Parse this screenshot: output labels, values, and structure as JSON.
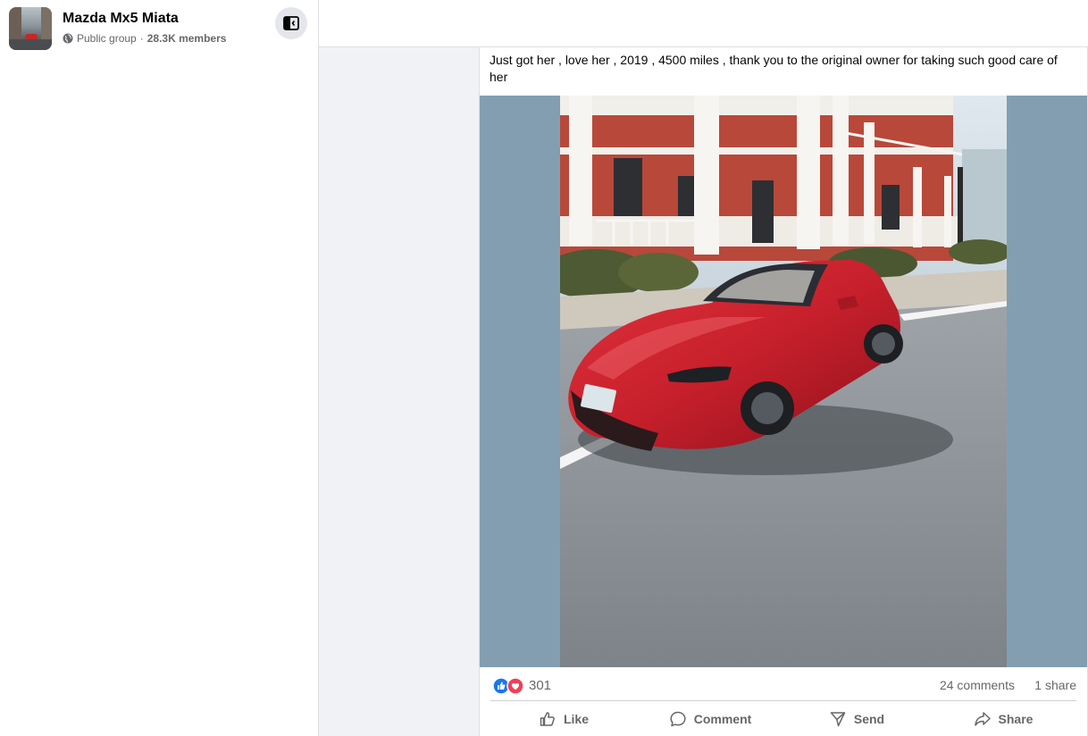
{
  "group": {
    "name": "Mazda Mx5 Miata",
    "privacy": "Public group",
    "separator": "·",
    "members": "28.3K members"
  },
  "post": {
    "text": "Just got her , love her , 2019 , 4500 miles , thank you to the original owner for taking such good care of her",
    "image": {
      "description_icon": "car-photo",
      "car_color": "#c8202c"
    }
  },
  "reactions": {
    "count": "301",
    "types": [
      "like",
      "love"
    ],
    "comments": "24 comments",
    "shares": "1 share"
  },
  "actions": [
    {
      "label": "Like",
      "icon": "thumbs-up-icon"
    },
    {
      "label": "Comment",
      "icon": "speech-bubble-icon"
    },
    {
      "label": "Send",
      "icon": "send-icon"
    },
    {
      "label": "Share",
      "icon": "share-arrow-icon"
    }
  ],
  "colors": {
    "like_blue": "#1877f2",
    "love_red": "#f33e58",
    "photo_backdrop": "#839eb1"
  }
}
